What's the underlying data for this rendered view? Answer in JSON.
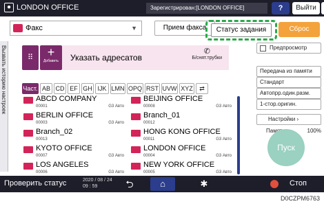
{
  "header": {
    "title": "LONDON OFFICE",
    "login_status": "Зарегистрирован:[LONDON OFFICE]",
    "help": "?",
    "logout": "Выйти"
  },
  "side_tab": {
    "label": "Вызвать историю настроек"
  },
  "function_select": {
    "value": "Факс"
  },
  "buttons": {
    "fax_receive": "Прием факса",
    "job_status": "Статус задания",
    "reset": "Сброс",
    "add_label": "Добавить"
  },
  "destination": {
    "label": "Указать адресатов",
    "handset": "Б/снят.трубки"
  },
  "tabs": [
    "Част.",
    "AB",
    "CD",
    "EF",
    "GH",
    "IJK",
    "LMN",
    "OPQ",
    "RST",
    "UVW",
    "XYZ",
    "⇄"
  ],
  "entries": [
    {
      "name": "ABCD COMPANY",
      "number": "00001",
      "mode": "G3 Авто"
    },
    {
      "name": "BEIJING OFFICE",
      "number": "00008",
      "mode": "G3 Авто"
    },
    {
      "name": "BERLIN OFFICE",
      "number": "00003",
      "mode": "G3 Авто"
    },
    {
      "name": "Branch_01",
      "number": "00012",
      "mode": ""
    },
    {
      "name": "Branch_02",
      "number": "00013",
      "mode": ""
    },
    {
      "name": "HONG KONG OFFICE",
      "number": "00011",
      "mode": "G3 Авто"
    },
    {
      "name": "KYOTO OFFICE",
      "number": "00007",
      "mode": "G3 Авто"
    },
    {
      "name": "LONDON OFFICE",
      "number": "00004",
      "mode": "G3 Авто"
    },
    {
      "name": "LOS ANGELES",
      "number": "00006",
      "mode": "G3 Авто"
    },
    {
      "name": "NEW YORK OFFICE",
      "number": "00005",
      "mode": "G3 Авто"
    }
  ],
  "right_panel": {
    "preview": "Предпросмотр",
    "memory_tx": "Передача из памяти",
    "standard": "Стандарт",
    "auto_reduce": "Автопрр.один.разм.",
    "one_sided": "1-стор.оригин.",
    "settings": "Настройки",
    "memory_label": "Память:",
    "memory_value": "100%",
    "start": "Пуск"
  },
  "bottom": {
    "check_status": "Проверить статус",
    "date": "2020 / 08 / 24",
    "time": "09 : 59",
    "stop": "Стоп"
  },
  "caption": "D0CZPM6763",
  "colors": {
    "accent": "#7a2a6a",
    "highlight": "#2aa84a",
    "reset": "#f4a23c",
    "start": "#9ad1c1",
    "bar": "#1e1e2a",
    "blue": "#2b3d8c"
  }
}
